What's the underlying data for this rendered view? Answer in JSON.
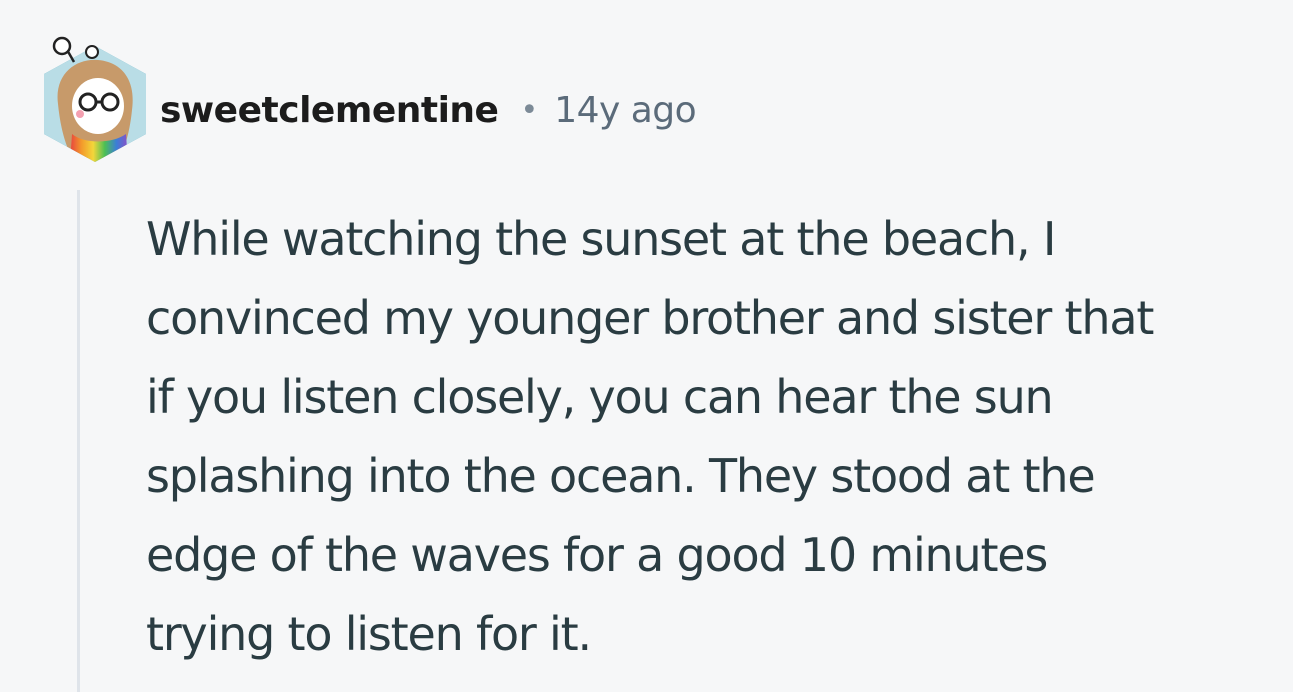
{
  "comment": {
    "author": "sweetclementine",
    "separator": "•",
    "age": "14y ago",
    "body_lines": [
      "While watching the sunset at the beach, I",
      "convinced my younger brother and sister that",
      "if you listen closely, you can hear the sun",
      "splashing into the ocean. They stood at the",
      "edge of the waves for a good 10 minutes",
      "trying to listen for it."
    ]
  },
  "colors": {
    "background": "#f6f7f8",
    "avatar_frame": "#47a3b8",
    "avatar_bg": "#b9dde6",
    "thread_line": "#dfe4ea",
    "text": "#2a3c42"
  }
}
